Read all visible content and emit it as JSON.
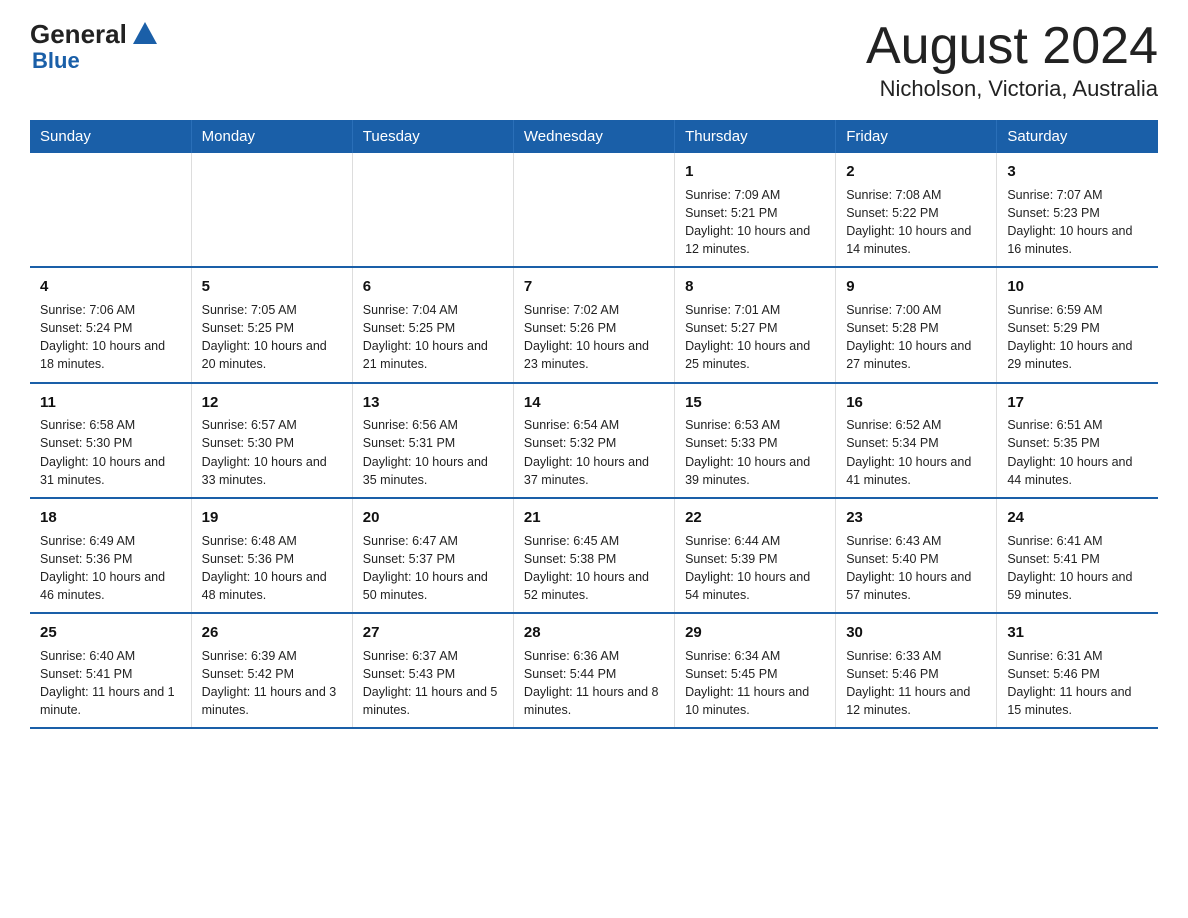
{
  "header": {
    "logo_general": "General",
    "logo_blue": "Blue",
    "month_title": "August 2024",
    "location": "Nicholson, Victoria, Australia"
  },
  "weekdays": [
    "Sunday",
    "Monday",
    "Tuesday",
    "Wednesday",
    "Thursday",
    "Friday",
    "Saturday"
  ],
  "weeks": [
    [
      {
        "day": "",
        "info": ""
      },
      {
        "day": "",
        "info": ""
      },
      {
        "day": "",
        "info": ""
      },
      {
        "day": "",
        "info": ""
      },
      {
        "day": "1",
        "info": "Sunrise: 7:09 AM\nSunset: 5:21 PM\nDaylight: 10 hours and 12 minutes."
      },
      {
        "day": "2",
        "info": "Sunrise: 7:08 AM\nSunset: 5:22 PM\nDaylight: 10 hours and 14 minutes."
      },
      {
        "day": "3",
        "info": "Sunrise: 7:07 AM\nSunset: 5:23 PM\nDaylight: 10 hours and 16 minutes."
      }
    ],
    [
      {
        "day": "4",
        "info": "Sunrise: 7:06 AM\nSunset: 5:24 PM\nDaylight: 10 hours and 18 minutes."
      },
      {
        "day": "5",
        "info": "Sunrise: 7:05 AM\nSunset: 5:25 PM\nDaylight: 10 hours and 20 minutes."
      },
      {
        "day": "6",
        "info": "Sunrise: 7:04 AM\nSunset: 5:25 PM\nDaylight: 10 hours and 21 minutes."
      },
      {
        "day": "7",
        "info": "Sunrise: 7:02 AM\nSunset: 5:26 PM\nDaylight: 10 hours and 23 minutes."
      },
      {
        "day": "8",
        "info": "Sunrise: 7:01 AM\nSunset: 5:27 PM\nDaylight: 10 hours and 25 minutes."
      },
      {
        "day": "9",
        "info": "Sunrise: 7:00 AM\nSunset: 5:28 PM\nDaylight: 10 hours and 27 minutes."
      },
      {
        "day": "10",
        "info": "Sunrise: 6:59 AM\nSunset: 5:29 PM\nDaylight: 10 hours and 29 minutes."
      }
    ],
    [
      {
        "day": "11",
        "info": "Sunrise: 6:58 AM\nSunset: 5:30 PM\nDaylight: 10 hours and 31 minutes."
      },
      {
        "day": "12",
        "info": "Sunrise: 6:57 AM\nSunset: 5:30 PM\nDaylight: 10 hours and 33 minutes."
      },
      {
        "day": "13",
        "info": "Sunrise: 6:56 AM\nSunset: 5:31 PM\nDaylight: 10 hours and 35 minutes."
      },
      {
        "day": "14",
        "info": "Sunrise: 6:54 AM\nSunset: 5:32 PM\nDaylight: 10 hours and 37 minutes."
      },
      {
        "day": "15",
        "info": "Sunrise: 6:53 AM\nSunset: 5:33 PM\nDaylight: 10 hours and 39 minutes."
      },
      {
        "day": "16",
        "info": "Sunrise: 6:52 AM\nSunset: 5:34 PM\nDaylight: 10 hours and 41 minutes."
      },
      {
        "day": "17",
        "info": "Sunrise: 6:51 AM\nSunset: 5:35 PM\nDaylight: 10 hours and 44 minutes."
      }
    ],
    [
      {
        "day": "18",
        "info": "Sunrise: 6:49 AM\nSunset: 5:36 PM\nDaylight: 10 hours and 46 minutes."
      },
      {
        "day": "19",
        "info": "Sunrise: 6:48 AM\nSunset: 5:36 PM\nDaylight: 10 hours and 48 minutes."
      },
      {
        "day": "20",
        "info": "Sunrise: 6:47 AM\nSunset: 5:37 PM\nDaylight: 10 hours and 50 minutes."
      },
      {
        "day": "21",
        "info": "Sunrise: 6:45 AM\nSunset: 5:38 PM\nDaylight: 10 hours and 52 minutes."
      },
      {
        "day": "22",
        "info": "Sunrise: 6:44 AM\nSunset: 5:39 PM\nDaylight: 10 hours and 54 minutes."
      },
      {
        "day": "23",
        "info": "Sunrise: 6:43 AM\nSunset: 5:40 PM\nDaylight: 10 hours and 57 minutes."
      },
      {
        "day": "24",
        "info": "Sunrise: 6:41 AM\nSunset: 5:41 PM\nDaylight: 10 hours and 59 minutes."
      }
    ],
    [
      {
        "day": "25",
        "info": "Sunrise: 6:40 AM\nSunset: 5:41 PM\nDaylight: 11 hours and 1 minute."
      },
      {
        "day": "26",
        "info": "Sunrise: 6:39 AM\nSunset: 5:42 PM\nDaylight: 11 hours and 3 minutes."
      },
      {
        "day": "27",
        "info": "Sunrise: 6:37 AM\nSunset: 5:43 PM\nDaylight: 11 hours and 5 minutes."
      },
      {
        "day": "28",
        "info": "Sunrise: 6:36 AM\nSunset: 5:44 PM\nDaylight: 11 hours and 8 minutes."
      },
      {
        "day": "29",
        "info": "Sunrise: 6:34 AM\nSunset: 5:45 PM\nDaylight: 11 hours and 10 minutes."
      },
      {
        "day": "30",
        "info": "Sunrise: 6:33 AM\nSunset: 5:46 PM\nDaylight: 11 hours and 12 minutes."
      },
      {
        "day": "31",
        "info": "Sunrise: 6:31 AM\nSunset: 5:46 PM\nDaylight: 11 hours and 15 minutes."
      }
    ]
  ]
}
